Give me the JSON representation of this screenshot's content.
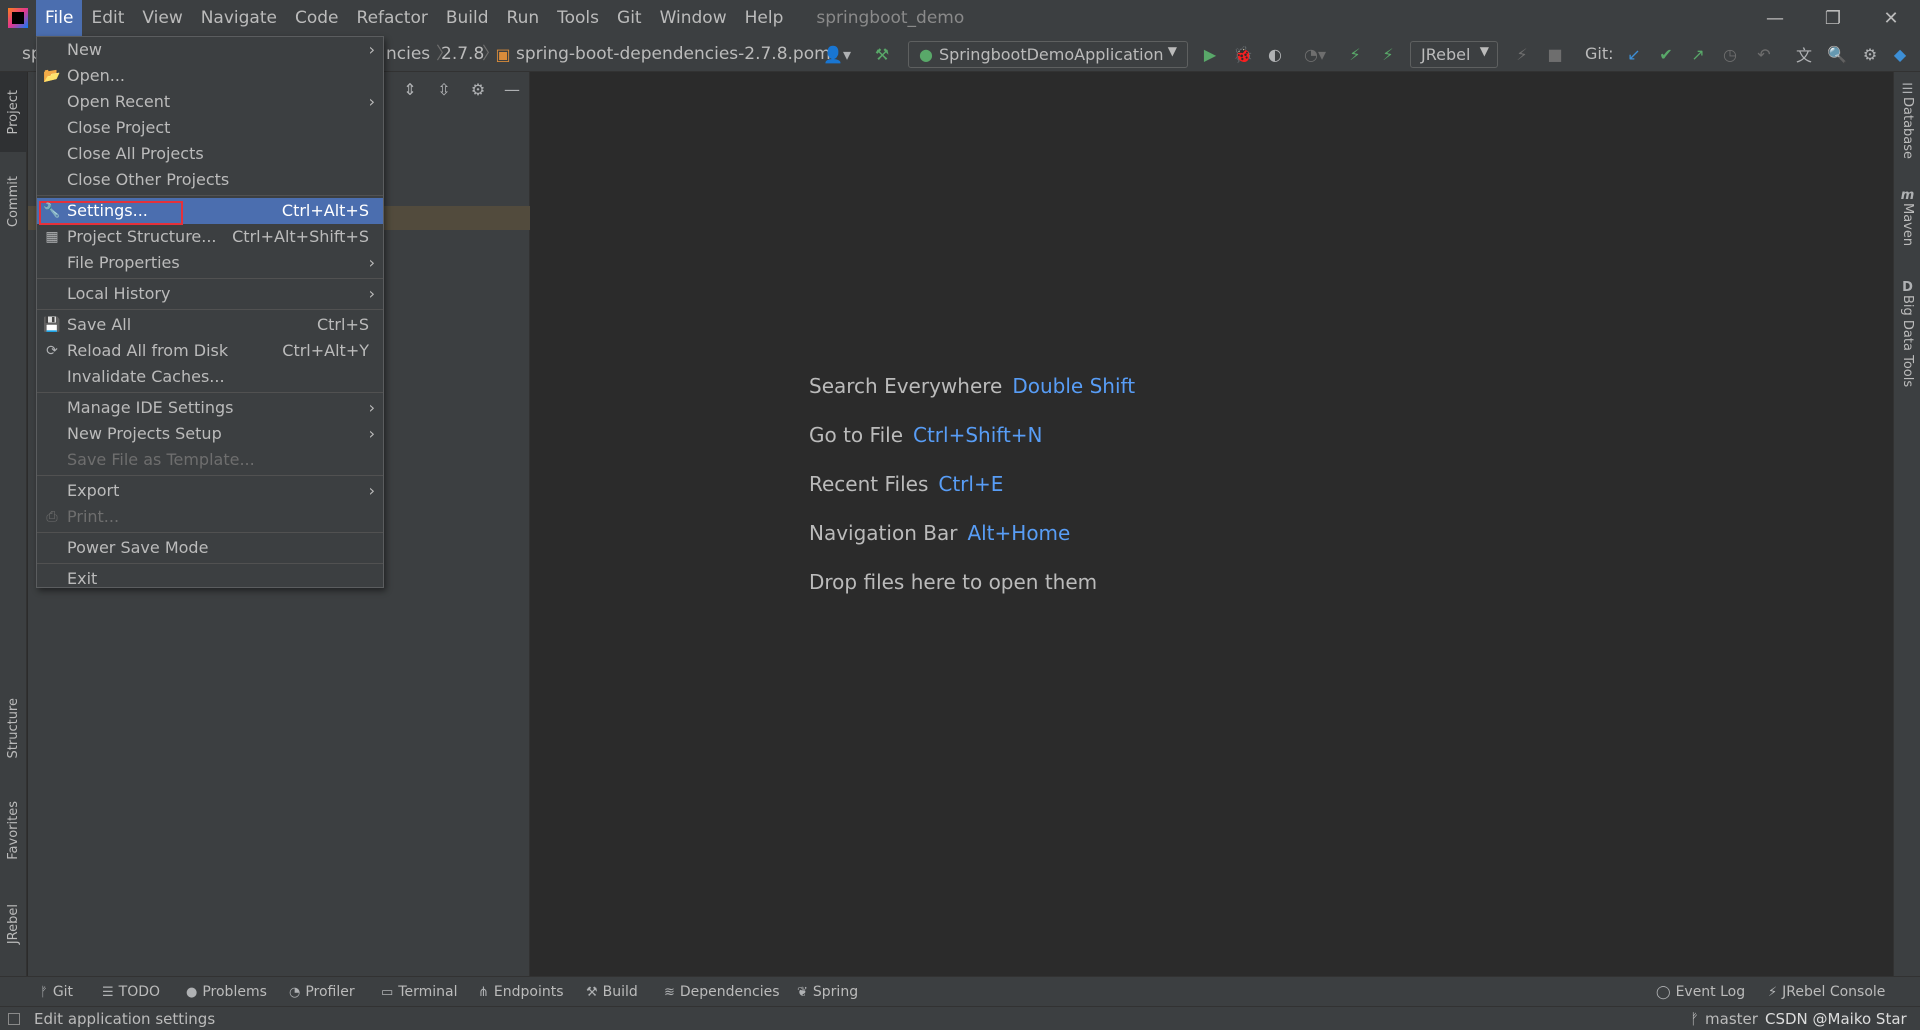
{
  "menubar": {
    "items": [
      "File",
      "Edit",
      "View",
      "Navigate",
      "Code",
      "Refactor",
      "Build",
      "Run",
      "Tools",
      "Git",
      "Window",
      "Help"
    ],
    "project_title": "springboot_demo",
    "window_controls": [
      "—",
      "❐",
      "✕"
    ]
  },
  "toolbar": {
    "breadcrumb_project": "sp",
    "breadcrumb_partial": "ncies",
    "breadcrumb_version": "2.7.8",
    "breadcrumb_file": "spring-boot-dependencies-2.7.8.pom",
    "run_config": "SpringbootDemoApplication",
    "jrebel_config": "JRebel",
    "git_label": "Git:"
  },
  "left_strip": {
    "tabs": [
      "Project",
      "Commit",
      "Structure",
      "Favorites",
      "JRebel"
    ]
  },
  "right_strip": {
    "tabs": [
      "Database",
      "Maven",
      "Big Data Tools"
    ]
  },
  "file_menu": {
    "items": [
      {
        "label": "New",
        "submenu": true
      },
      {
        "label": "Open...",
        "icon": "folder-icon"
      },
      {
        "label": "Open Recent",
        "submenu": true
      },
      {
        "label": "Close Project"
      },
      {
        "label": "Close All Projects"
      },
      {
        "label": "Close Other Projects"
      },
      {
        "label": "Settings...",
        "shortcut": "Ctrl+Alt+S",
        "icon": "wrench-icon",
        "highlighted": true
      },
      {
        "label": "Project Structure...",
        "shortcut": "Ctrl+Alt+Shift+S",
        "icon": "project-structure-icon"
      },
      {
        "label": "File Properties",
        "submenu": true
      },
      {
        "label": "Local History",
        "submenu": true
      },
      {
        "label": "Save All",
        "shortcut": "Ctrl+S",
        "icon": "save-icon"
      },
      {
        "label": "Reload All from Disk",
        "shortcut": "Ctrl+Alt+Y",
        "icon": "reload-icon"
      },
      {
        "label": "Invalidate Caches..."
      },
      {
        "label": "Manage IDE Settings",
        "submenu": true
      },
      {
        "label": "New Projects Setup",
        "submenu": true
      },
      {
        "label": "Save File as Template...",
        "disabled": true
      },
      {
        "label": "Export",
        "submenu": true
      },
      {
        "label": "Print...",
        "disabled": true,
        "icon": "print-icon"
      },
      {
        "label": "Power Save Mode"
      },
      {
        "label": "Exit"
      }
    ]
  },
  "editor": {
    "hints": [
      {
        "text": "Search Everywhere",
        "key": "Double Shift"
      },
      {
        "text": "Go to File",
        "key": "Ctrl+Shift+N"
      },
      {
        "text": "Recent Files",
        "key": "Ctrl+E"
      },
      {
        "text": "Navigation Bar",
        "key": "Alt+Home"
      },
      {
        "text": "Drop files here to open them",
        "key": ""
      }
    ]
  },
  "bottom_bar": {
    "left": [
      "Git",
      "TODO",
      "Problems",
      "Profiler",
      "Terminal",
      "Endpoints",
      "Build",
      "Dependencies",
      "Spring"
    ],
    "right": [
      "Event Log",
      "JRebel Console"
    ]
  },
  "status_bar": {
    "text": "Edit application settings",
    "branch": "master",
    "watermark": "CSDN @Maiko Star"
  },
  "colors": {
    "menu_highlight": "#4b6eaf",
    "hint_key": "#589df6",
    "settings_outline": "#e5313a"
  }
}
